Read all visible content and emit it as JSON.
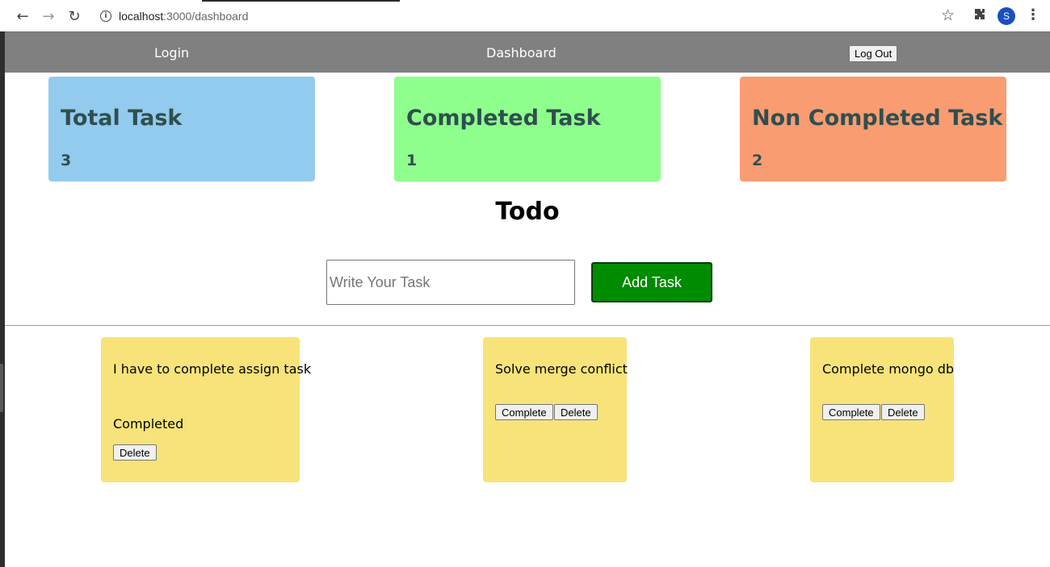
{
  "browser": {
    "url_host": "localhost",
    "url_rest": ":3000/dashboard",
    "profile_initial": "S"
  },
  "navbar": {
    "login_label": "Login",
    "dashboard_label": "Dashboard",
    "logout_label": "Log Out"
  },
  "stats": [
    {
      "title": "Total Task",
      "count": "3",
      "color": "#93cbee"
    },
    {
      "title": "Completed Task",
      "count": "1",
      "color": "#8eff8c"
    },
    {
      "title": "Non Completed Task",
      "count": "2",
      "color": "#f99c71"
    }
  ],
  "todo": {
    "heading": "Todo",
    "input_placeholder": "Write Your Task",
    "add_button_label": "Add Task"
  },
  "tasks": [
    {
      "text": "I have to complete assign task",
      "status": "Completed",
      "delete_label": "Delete"
    },
    {
      "text": "Solve merge conflict",
      "complete_label": "Complete",
      "delete_label": "Delete"
    },
    {
      "text": "Complete mongo db",
      "complete_label": "Complete",
      "delete_label": "Delete"
    }
  ],
  "colors": {
    "navbar": "#808080",
    "task_card": "#f7e37a",
    "add_button": "#008c00"
  }
}
